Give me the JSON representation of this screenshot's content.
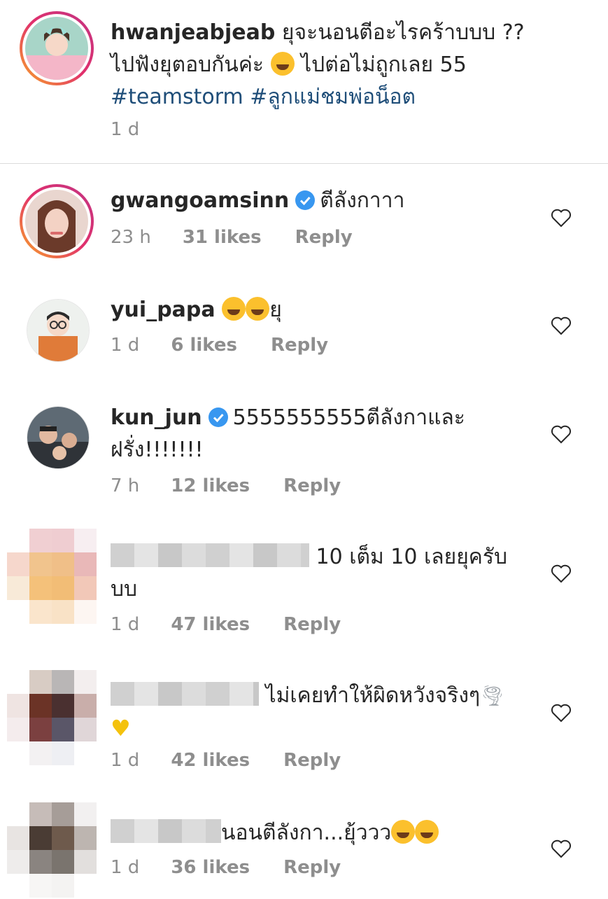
{
  "caption": {
    "username": "hwanjeabjeab",
    "line1": "ยุจะนอนตีอะไรคร้าบบบ ??",
    "line2a": "ไปฟังยุตอบกันค่ะ",
    "line2b": "ไปต่อไม่ถูกเลย 55",
    "hashtags": "#teamstorm #ลูกแม่ชมพ่อน็อต",
    "time": "1 d"
  },
  "comments": [
    {
      "username": "gwangoamsinn",
      "verified": true,
      "text": "ตีลังกาาา",
      "time": "23 h",
      "likes": "31 likes",
      "reply": "Reply"
    },
    {
      "username": "yui_papa",
      "verified": false,
      "text": "ยุ",
      "time": "1 d",
      "likes": "6 likes",
      "reply": "Reply"
    },
    {
      "username": "kun_jun",
      "verified": true,
      "text": "5555555555ตีลังกาและ",
      "text2": "ฝรั่ง!!!!!!!",
      "time": "7 h",
      "likes": "12 likes",
      "reply": "Reply"
    },
    {
      "text": "10 เต็ม 10 เลยยุครับ",
      "text2": "บบ",
      "time": "1 d",
      "likes": "47 likes",
      "reply": "Reply"
    },
    {
      "text": "ไม่เคยทำให้ผิดหวังจริงๆ",
      "time": "1 d",
      "likes": "42 likes",
      "reply": "Reply"
    },
    {
      "text": "นอนตีลังกา...ยุ้ววว",
      "time": "1 d",
      "likes": "36 likes",
      "reply": "Reply"
    }
  ],
  "colors": {
    "link": "#1f4e79",
    "meta": "#8e8e8e",
    "verified": "#3897f0",
    "divider": "#dbdbdb"
  },
  "icons": [
    "heart-outline-icon",
    "verified-badge-icon",
    "rofl-emoji-icon",
    "sweat-smile-emoji-icon",
    "joy-emoji-icon",
    "tornado-emoji-icon",
    "yellow-heart-emoji-icon"
  ]
}
